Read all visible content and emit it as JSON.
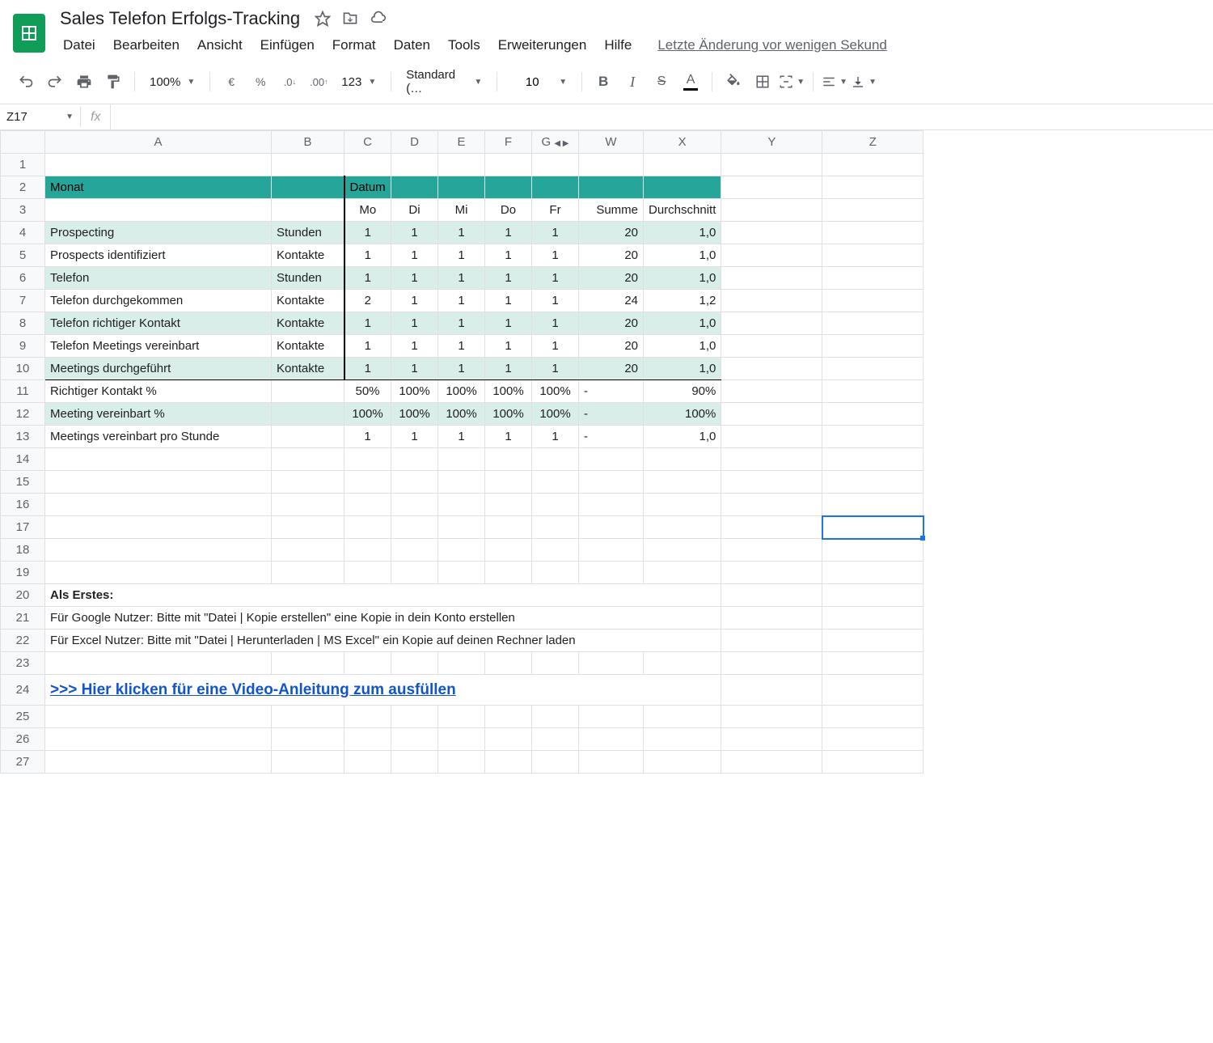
{
  "doc": {
    "title": "Sales Telefon Erfolgs-Tracking"
  },
  "menubar": {
    "items": [
      "Datei",
      "Bearbeiten",
      "Ansicht",
      "Einfügen",
      "Format",
      "Daten",
      "Tools",
      "Erweiterungen",
      "Hilfe"
    ],
    "lastEdit": "Letzte Änderung vor wenigen Sekund"
  },
  "toolbar": {
    "zoom": "100%",
    "currency": "€",
    "percent": "%",
    "decDec": ".0",
    "incDec": ".00",
    "format123": "123",
    "font": "Standard (…",
    "fontSize": "10"
  },
  "formulaBar": {
    "nameBox": "Z17",
    "fx": "fx",
    "formula": ""
  },
  "columns": [
    "A",
    "B",
    "C",
    "D",
    "E",
    "F",
    "G",
    "W",
    "X",
    "Y",
    "Z"
  ],
  "rowNumbers": [
    "1",
    "2",
    "3",
    "4",
    "5",
    "6",
    "7",
    "8",
    "9",
    "10",
    "11",
    "12",
    "13",
    "14",
    "15",
    "16",
    "17",
    "18",
    "19",
    "20",
    "21",
    "22",
    "23",
    "24",
    "25",
    "26",
    "27"
  ],
  "sheet": {
    "monat": "Monat",
    "datum": "Datum",
    "days": [
      "Mo",
      "Di",
      "Mi",
      "Do",
      "Fr"
    ],
    "summe": "Summe",
    "durchschnitt": "Durchschnitt",
    "rows": [
      {
        "label": "Prospecting",
        "unit": "Stunden",
        "vals": [
          "1",
          "1",
          "1",
          "1",
          "1"
        ],
        "sum": "20",
        "avg": "1,0",
        "mint": true
      },
      {
        "label": "Prospects identifiziert",
        "unit": "Kontakte",
        "vals": [
          "1",
          "1",
          "1",
          "1",
          "1"
        ],
        "sum": "20",
        "avg": "1,0",
        "mint": false
      },
      {
        "label": "Telefon",
        "unit": "Stunden",
        "vals": [
          "1",
          "1",
          "1",
          "1",
          "1"
        ],
        "sum": "20",
        "avg": "1,0",
        "mint": true
      },
      {
        "label": "Telefon durchgekommen",
        "unit": "Kontakte",
        "vals": [
          "2",
          "1",
          "1",
          "1",
          "1"
        ],
        "sum": "24",
        "avg": "1,2",
        "mint": false
      },
      {
        "label": "Telefon richtiger Kontakt",
        "unit": "Kontakte",
        "vals": [
          "1",
          "1",
          "1",
          "1",
          "1"
        ],
        "sum": "20",
        "avg": "1,0",
        "mint": true
      },
      {
        "label": "Telefon Meetings vereinbart",
        "unit": "Kontakte",
        "vals": [
          "1",
          "1",
          "1",
          "1",
          "1"
        ],
        "sum": "20",
        "avg": "1,0",
        "mint": false
      },
      {
        "label": "Meetings durchgeführt",
        "unit": "Kontakte",
        "vals": [
          "1",
          "1",
          "1",
          "1",
          "1"
        ],
        "sum": "20",
        "avg": "1,0",
        "mint": true,
        "bottom": true
      }
    ],
    "pctRows": [
      {
        "label": "Richtiger Kontakt %",
        "vals": [
          "50%",
          "100%",
          "100%",
          "100%",
          "100%"
        ],
        "sum": "-",
        "avg": "90%",
        "mint": false
      },
      {
        "label": "Meeting vereinbart %",
        "vals": [
          "100%",
          "100%",
          "100%",
          "100%",
          "100%"
        ],
        "sum": "-",
        "avg": "100%",
        "mint": true
      },
      {
        "label": "Meetings vereinbart pro Stunde",
        "vals": [
          "1",
          "1",
          "1",
          "1",
          "1"
        ],
        "sum": "-",
        "avg": "1,0",
        "mint": false
      }
    ],
    "instructions": {
      "heading": "Als Erstes:",
      "line1": "Für Google Nutzer: Bitte mit \"Datei | Kopie erstellen\" eine Kopie in dein Konto erstellen",
      "line2": "Für Excel Nutzer: Bitte mit \"Datei | Herunterladen | MS Excel\" ein Kopie auf deinen Rechner laden",
      "link": ">>> Hier klicken für eine Video-Anleitung zum ausfüllen"
    }
  },
  "selectedCell": "Z17"
}
